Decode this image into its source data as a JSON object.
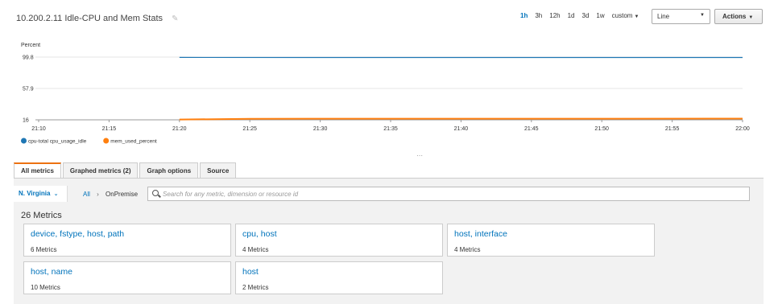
{
  "header": {
    "title": "10.200.2.11 Idle-CPU and Mem Stats",
    "ranges": [
      "1h",
      "3h",
      "12h",
      "1d",
      "3d",
      "1w"
    ],
    "active_range": "1h",
    "custom_label": "custom",
    "view_select": "Line",
    "actions_label": "Actions"
  },
  "chart_data": {
    "type": "line",
    "ylabel": "Percent",
    "yticks": [
      16,
      57.9,
      99.8
    ],
    "ylim": [
      16,
      99.8
    ],
    "x_ticks": [
      "21:10",
      "21:15",
      "21:20",
      "21:25",
      "21:30",
      "21:35",
      "21:40",
      "21:45",
      "21:50",
      "21:55",
      "22:00"
    ],
    "xlim": [
      "21:10",
      "22:00"
    ],
    "series": [
      {
        "name": "cpu-total cpu_usage_idle",
        "color": "#1f77b4",
        "x": [
          "21:20",
          "21:30",
          "21:40",
          "21:50",
          "22:00"
        ],
        "values": [
          99.4,
          99.3,
          99.3,
          99.3,
          99.3
        ]
      },
      {
        "name": "mem_used_percent",
        "color": "#ff7f0e",
        "x": [
          "21:20",
          "21:25",
          "21:30",
          "21:40",
          "21:50",
          "22:00"
        ],
        "values": [
          16.4,
          17.3,
          17.5,
          17.5,
          17.5,
          17.6
        ]
      }
    ],
    "legend_position": "bottom-left",
    "grid": true
  },
  "tabs": [
    "All metrics",
    "Graphed metrics (2)",
    "Graph options",
    "Source"
  ],
  "active_tab": "All metrics",
  "browser": {
    "region": "N. Virginia",
    "breadcrumb_all": "All",
    "breadcrumb_current": "OnPremise",
    "search_placeholder": "Search for any metric, dimension or resource id",
    "metrics_count": "26 Metrics",
    "cards": [
      {
        "title": "device, fstype, host, path",
        "count": "6 Metrics"
      },
      {
        "title": "cpu, host",
        "count": "4 Metrics"
      },
      {
        "title": "host, interface",
        "count": "4 Metrics"
      },
      {
        "title": "host, name",
        "count": "10 Metrics"
      },
      {
        "title": "host",
        "count": "2 Metrics"
      }
    ]
  },
  "colors": {
    "accent": "#0073bb",
    "tab_active": "#ec7211",
    "panel_bg": "#f2f2f2"
  }
}
